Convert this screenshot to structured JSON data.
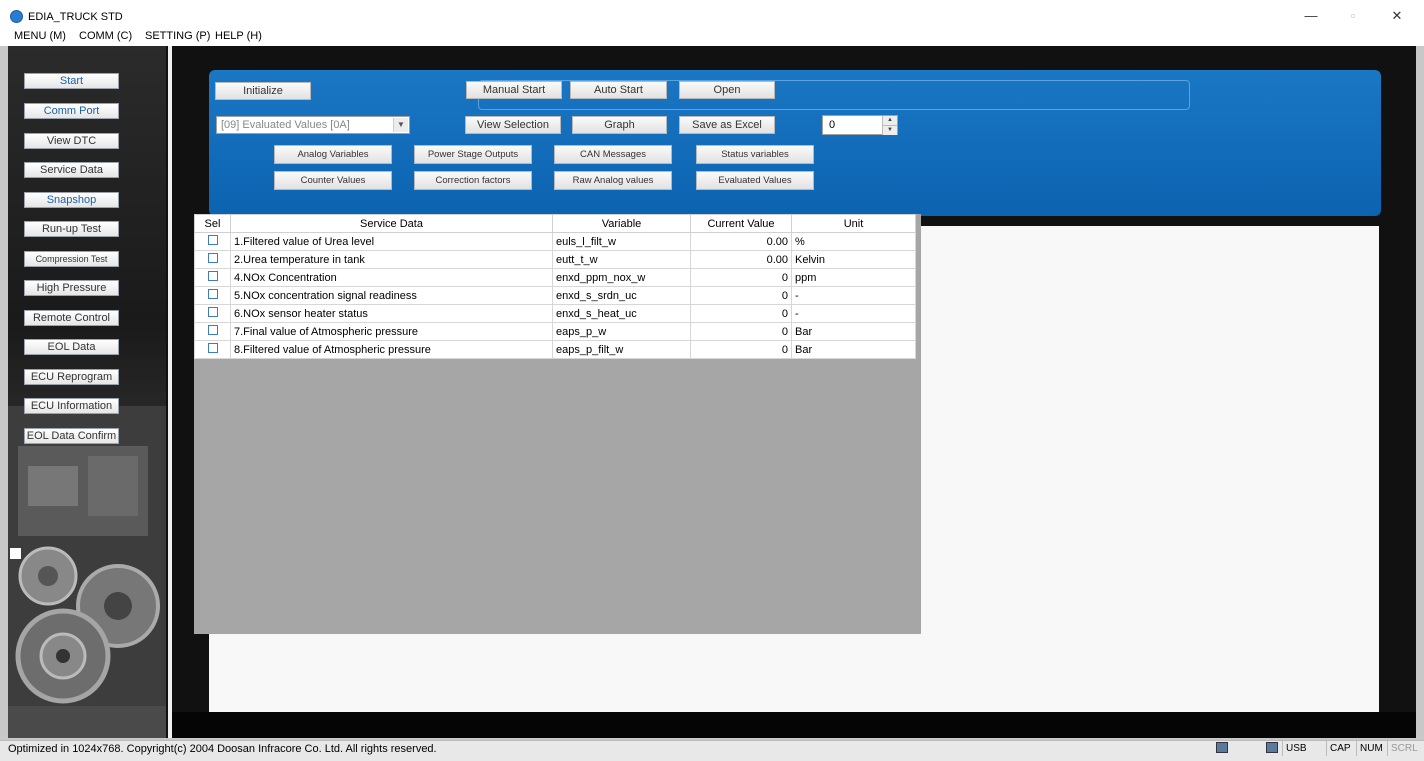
{
  "window": {
    "title": "EDIA_TRUCK STD",
    "controls": {
      "minimize": "—",
      "maximize": "▫",
      "close": "✕"
    }
  },
  "menu": [
    "MENU (M)",
    "COMM (C)",
    "SETTING (P)",
    "HELP (H)"
  ],
  "sidebar": {
    "items": [
      {
        "label": "Start",
        "active": true
      },
      {
        "label": "Comm Port",
        "active": true
      },
      {
        "label": "View DTC",
        "active": false
      },
      {
        "label": "Service Data",
        "active": false
      },
      {
        "label": "Snapshop",
        "active": true
      },
      {
        "label": "Run-up Test",
        "active": false
      },
      {
        "label": "Compression Test",
        "active": false
      },
      {
        "label": "High Pressure",
        "active": false
      },
      {
        "label": "Remote Control",
        "active": false
      },
      {
        "label": "EOL Data",
        "active": false
      },
      {
        "label": "ECU Reprogram",
        "active": false
      },
      {
        "label": "ECU Information",
        "active": false
      },
      {
        "label": "EOL Data Confirm",
        "active": false
      }
    ]
  },
  "toolbar": {
    "initialize": "Initialize",
    "manual_start": "Manual Start",
    "auto_start": "Auto Start",
    "open": "Open",
    "combo_value": "[09] Evaluated Values [0A]",
    "view_selection": "View Selection",
    "graph": "Graph",
    "save_as_excel": "Save as Excel",
    "spin_value": "0",
    "categories": [
      "Analog Variables",
      "Power Stage Outputs",
      "CAN Messages",
      "Status variables",
      "Counter Values",
      "Correction factors",
      "Raw Analog values",
      "Evaluated Values"
    ]
  },
  "grid": {
    "headers": [
      "Sel",
      "Service Data",
      "Variable",
      "Current Value",
      "Unit"
    ],
    "rows": [
      {
        "name": "1.Filtered value of Urea level",
        "variable": "euls_l_filt_w",
        "value": "0.00",
        "unit": "%"
      },
      {
        "name": "2.Urea temperature in tank",
        "variable": "eutt_t_w",
        "value": "0.00",
        "unit": "Kelvin"
      },
      {
        "name": "4.NOx Concentration",
        "variable": "enxd_ppm_nox_w",
        "value": "0",
        "unit": "ppm"
      },
      {
        "name": "5.NOx concentration signal readiness",
        "variable": "enxd_s_srdn_uc",
        "value": "0",
        "unit": "-"
      },
      {
        "name": "6.NOx sensor heater status",
        "variable": "enxd_s_heat_uc",
        "value": "0",
        "unit": "-"
      },
      {
        "name": "7.Final value of Atmospheric pressure",
        "variable": "eaps_p_w",
        "value": "0",
        "unit": "Bar"
      },
      {
        "name": "8.Filtered value of Atmospheric pressure",
        "variable": "eaps_p_filt_w",
        "value": "0",
        "unit": "Bar"
      }
    ]
  },
  "statusbar": {
    "text": "Optimized in 1024x768. Copyright(c) 2004 Doosan Infracore Co. Ltd. All rights reserved.",
    "indicators": [
      "USB",
      "CAP",
      "NUM",
      "SCRL"
    ]
  },
  "colors": {
    "accent": "#0c63b0",
    "active_text": "#1f5fa8"
  }
}
